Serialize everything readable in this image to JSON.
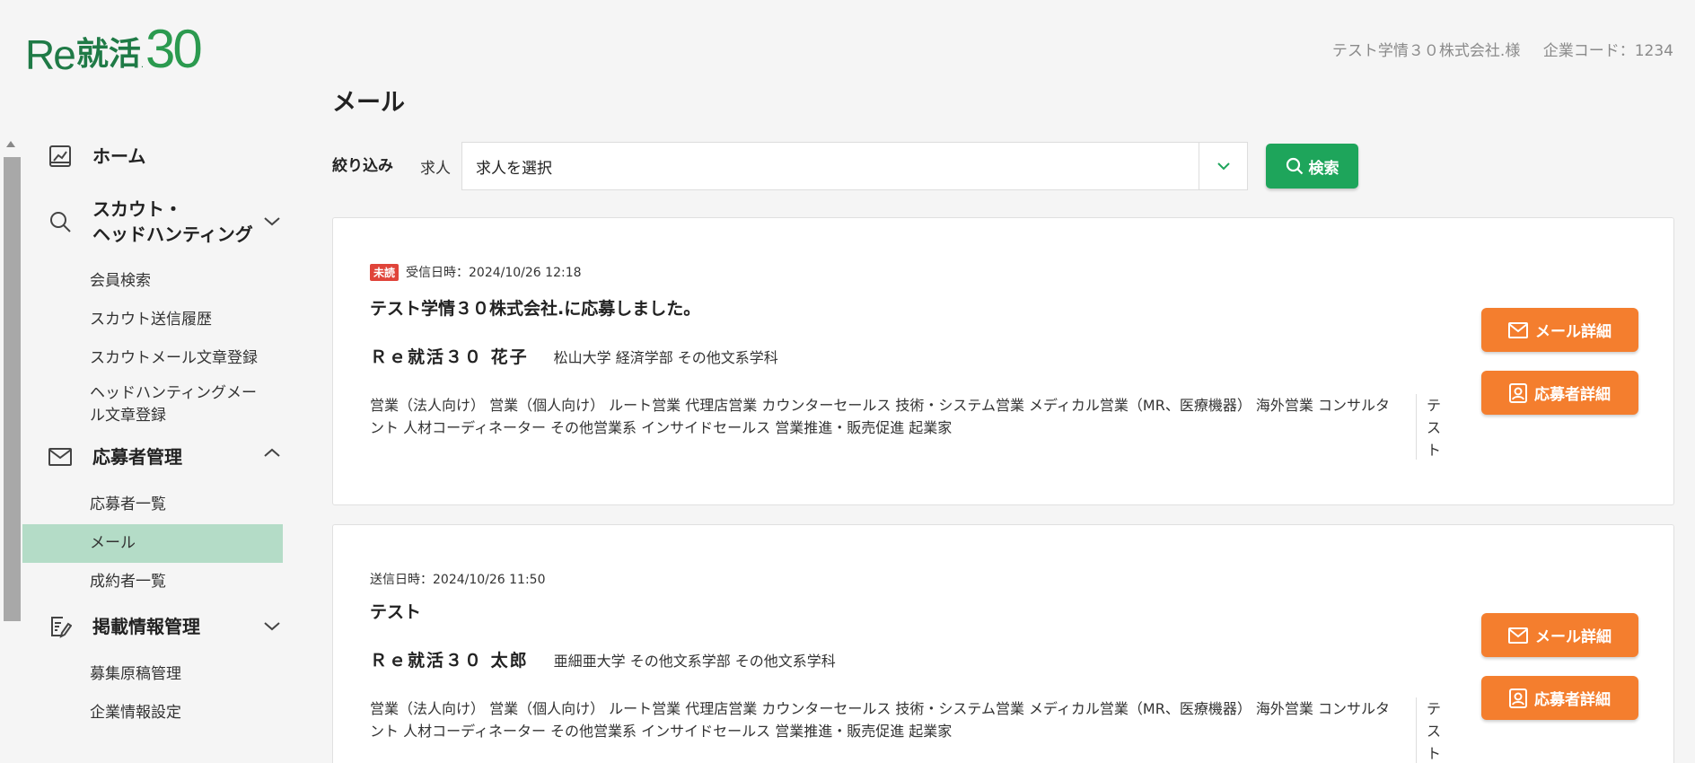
{
  "header": {
    "logo_prefix": "Re",
    "logo_kanji": "就活",
    "logo_dot": ".",
    "logo_number": "30",
    "company_name": "テスト学情３０株式会社.様",
    "company_code": "企業コード：1234"
  },
  "sidebar": {
    "home": "ホーム",
    "scout": "スカウト・\nヘッドハンティング",
    "scout_items": [
      "会員検索",
      "スカウト送信履歴",
      "スカウトメール文章登録",
      "ヘッドハンティングメー\nル文章登録"
    ],
    "applicants": "応募者管理",
    "applicant_items": [
      "応募者一覧",
      "メール",
      "成約者一覧"
    ],
    "listing": "掲載情報管理",
    "listing_items": [
      "募集原稿管理",
      "企業情報設定"
    ]
  },
  "main": {
    "title": "メール",
    "filter_label": "絞り込み",
    "filter_sub": "求人",
    "select_value": "求人を選択",
    "search_label": "検索"
  },
  "messages": [
    {
      "badge": "未読",
      "date": "受信日時：2024/10/26 12:18",
      "subject": "テスト学情３０株式会社.に応募しました。",
      "name": "Ｒｅ就活３０ 花子",
      "school": "松山大学 経済学部 その他文系学科",
      "jobs": "営業（法人向け） 営業（個人向け） ルート営業 代理店営業 カウンターセールス 技術・システム営業 メディカル営業（MR、医療機器） 海外営業 コンサルタント 人材コーディネーター その他営業系 インサイドセールス 営業推進・販売促進 起業家",
      "tag": "テスト",
      "mail_btn": "メール詳細",
      "applicant_btn": "応募者詳細"
    },
    {
      "badge": "",
      "date": "送信日時：2024/10/26 11:50",
      "subject": "テスト",
      "name": "Ｒｅ就活３０ 太郎",
      "school": "亜細亜大学 その他文系学部 その他文系学科",
      "jobs": "営業（法人向け） 営業（個人向け） ルート営業 代理店営業 カウンターセールス 技術・システム営業 メディカル営業（MR、医療機器） 海外営業 コンサルタント 人材コーディネーター その他営業系 インサイドセールス 営業推進・販売促進 起業家",
      "tag": "テスト",
      "mail_btn": "メール詳細",
      "applicant_btn": "応募者詳細"
    }
  ],
  "colors": {
    "brand_green": "#1ea55b",
    "accent_orange": "#f47e2e",
    "active_nav": "#b4dcc7",
    "unread_badge": "#e0443a"
  }
}
